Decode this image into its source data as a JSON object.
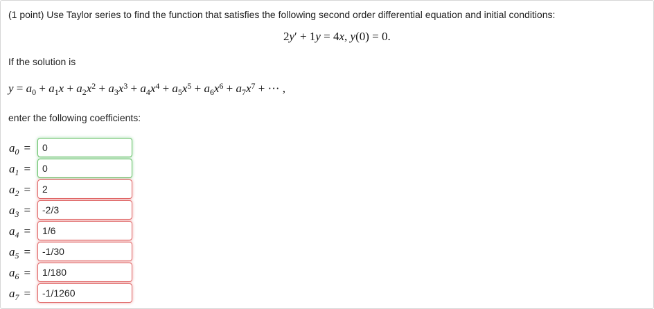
{
  "problem": {
    "statement": "(1 point) Use Taylor series to find the function that satisfies the following second order differential equation and initial conditions:",
    "solution_intro": "If the solution is",
    "enter_label": "enter the following coefficients:"
  },
  "equation": {
    "lhs_coef1": "2",
    "lhs_var1": "y",
    "prime": "′",
    "plus": " + ",
    "lhs_coef2": "1",
    "lhs_var2": "y",
    "equals": " = ",
    "rhs_coef": "4",
    "rhs_var": "x",
    "comma": ", ",
    "ic_func": "y",
    "ic_arg": "(0)",
    "ic_value": " = 0."
  },
  "series": {
    "lhs": "y",
    "equals": " = ",
    "ellipsis": " + ··· ,"
  },
  "coefficients": [
    {
      "name": "a",
      "sub": "0",
      "value": "0",
      "status": "correct"
    },
    {
      "name": "a",
      "sub": "1",
      "value": "0",
      "status": "correct"
    },
    {
      "name": "a",
      "sub": "2",
      "value": "2",
      "status": "incorrect"
    },
    {
      "name": "a",
      "sub": "3",
      "value": "-2/3",
      "status": "incorrect"
    },
    {
      "name": "a",
      "sub": "4",
      "value": "1/6",
      "status": "incorrect"
    },
    {
      "name": "a",
      "sub": "5",
      "value": "-1/30",
      "status": "incorrect"
    },
    {
      "name": "a",
      "sub": "6",
      "value": "1/180",
      "status": "incorrect"
    },
    {
      "name": "a",
      "sub": "7",
      "value": "-1/1260",
      "status": "incorrect"
    }
  ],
  "colors": {
    "correct_border": "#6ac26a",
    "incorrect_border": "#e06a6a"
  }
}
